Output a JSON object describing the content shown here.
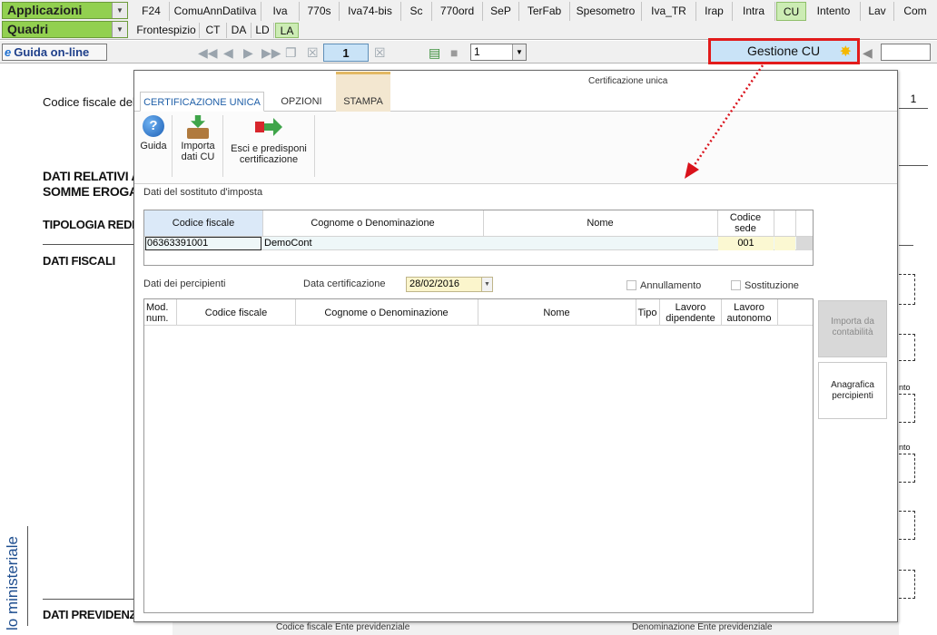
{
  "toolbar": {
    "applicazioni": "Applicazioni",
    "quadri": "Quadri",
    "tabs": [
      "F24",
      "ComuAnnDatiIva",
      "Iva",
      "770s",
      "Iva74-bis",
      "Sc",
      "770ord",
      "SeP",
      "TerFab",
      "Spesometro",
      "Iva_TR",
      "Irap",
      "Intra",
      "CU",
      "Intento",
      "Lav",
      "Com"
    ],
    "active_tab": "CU",
    "subtabs": [
      "Frontespizio",
      "CT",
      "DA",
      "LD",
      "LA"
    ],
    "active_subtab": "LA"
  },
  "navbar": {
    "guida_online": "Guida on-line",
    "page_number": "1",
    "select_value": "1",
    "gestione_cu": "Gestione CU"
  },
  "document": {
    "codice_fiscale_label": "Codice fiscale del p",
    "dati_relativi_1": "DATI RELATIVI AL",
    "dati_relativi_2": "SOMME EROGAT",
    "tipologia": "TIPOLOGIA REDDIT",
    "dati_fiscali": "DATI FISCALI",
    "dati_previdenziali": "DATI PREVIDENZIA",
    "vertical_label": "lo ministeriale",
    "page_box": "1",
    "cf_ente": "Codice fiscale Ente previdenziale",
    "den_ente": "Denominazione Ente previdenziale",
    "nto_1": "nto",
    "nto_2": "nto"
  },
  "dialog": {
    "title": "Certificazione unica",
    "tabs": [
      "CERTIFICAZIONE UNICA",
      "OPZIONI",
      "STAMPA"
    ],
    "ribbon": {
      "guida": "Guida",
      "importa_1": "Importa",
      "importa_2": "dati CU",
      "esci_1": "Esci e predisponi",
      "esci_2": "certificazione"
    },
    "sostituto_label": "Dati del sostituto d'imposta",
    "sostituto_headers": {
      "codice_fiscale": "Codice fiscale",
      "cognome": "Cognome o Denominazione",
      "nome": "Nome",
      "codice_sede_1": "Codice",
      "codice_sede_2": "sede"
    },
    "sostituto_row": {
      "codice_fiscale": "06363391001",
      "cognome": "DemoCont",
      "nome": "",
      "codice_sede": "001"
    },
    "percipienti_label": "Dati dei percipienti",
    "data_cert_label": "Data certificazione",
    "data_cert_value": "28/02/2016",
    "annullamento": "Annullamento",
    "sostituzione": "Sostituzione",
    "percipienti_headers": {
      "mod_1": "Mod.",
      "mod_2": "num.",
      "codice_fiscale": "Codice fiscale",
      "cognome": "Cognome o Denominazione",
      "nome": "Nome",
      "tipo": "Tipo",
      "lav_dip_1": "Lavoro",
      "lav_dip_2": "dipendente",
      "lav_aut_1": "Lavoro",
      "lav_aut_2": "autonomo"
    },
    "importa_contabilita_1": "Importa da",
    "importa_contabilita_2": "contabilità",
    "anagrafica_1": "Anagrafica",
    "anagrafica_2": "percipienti"
  },
  "colors": {
    "combo_green": "#92d050",
    "active_tab": "#ccecb4",
    "highlight_red": "#e21b1b",
    "arrow_red": "#d9121b",
    "link_blue": "#1f5fa8"
  }
}
